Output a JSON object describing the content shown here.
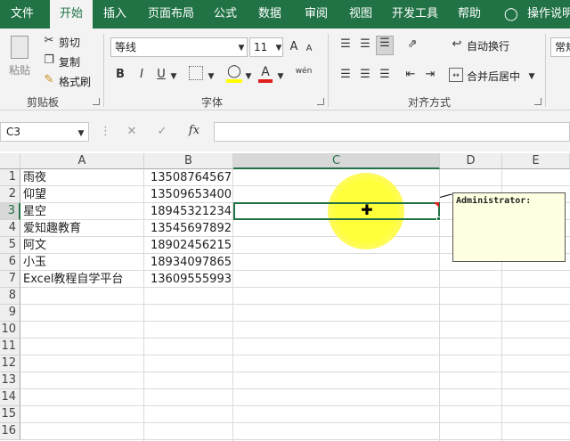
{
  "tabs": [
    "文件",
    "开始",
    "插入",
    "页面布局",
    "公式",
    "数据",
    "审阅",
    "视图",
    "开发工具",
    "帮助",
    "操作说明"
  ],
  "active_tab_index": 1,
  "ribbon": {
    "clipboard": {
      "paste": "粘贴",
      "cut": "剪切",
      "copy": "复制",
      "format_painter": "格式刷",
      "label": "剪贴板"
    },
    "font": {
      "name": "等线",
      "size": "11",
      "bold": "B",
      "italic": "I",
      "underline": "U",
      "grow": "A",
      "shrink": "A",
      "phonetic": "wén",
      "label": "字体"
    },
    "alignment": {
      "wrap_text": "自动换行",
      "merge_center": "合并后居中",
      "label": "对齐方式"
    },
    "number": {
      "format": "常规"
    }
  },
  "formula_bar": {
    "name_box": "C3",
    "fx": "fx",
    "value": ""
  },
  "columns": [
    "A",
    "B",
    "C",
    "D",
    "E"
  ],
  "rows": [
    "1",
    "2",
    "3",
    "4",
    "5",
    "6",
    "7",
    "8",
    "9",
    "10",
    "11",
    "12",
    "13",
    "14",
    "15",
    "16"
  ],
  "data": [
    {
      "name": "雨夜",
      "phone": "13508764567"
    },
    {
      "name": "仰望",
      "phone": "13509653400"
    },
    {
      "name": "星空",
      "phone": "18945321234"
    },
    {
      "name": "爱知趣教育",
      "phone": "13545697892"
    },
    {
      "name": "阿文",
      "phone": "18902456215"
    },
    {
      "name": "小玉",
      "phone": "18934097865"
    },
    {
      "name": "Excel教程自学平台",
      "phone": "13609555993"
    }
  ],
  "comment": {
    "author": "Administrator:"
  },
  "colors": {
    "accent": "#217346",
    "comment_bg": "#ffffe1",
    "highlight": "#ffff3a"
  }
}
